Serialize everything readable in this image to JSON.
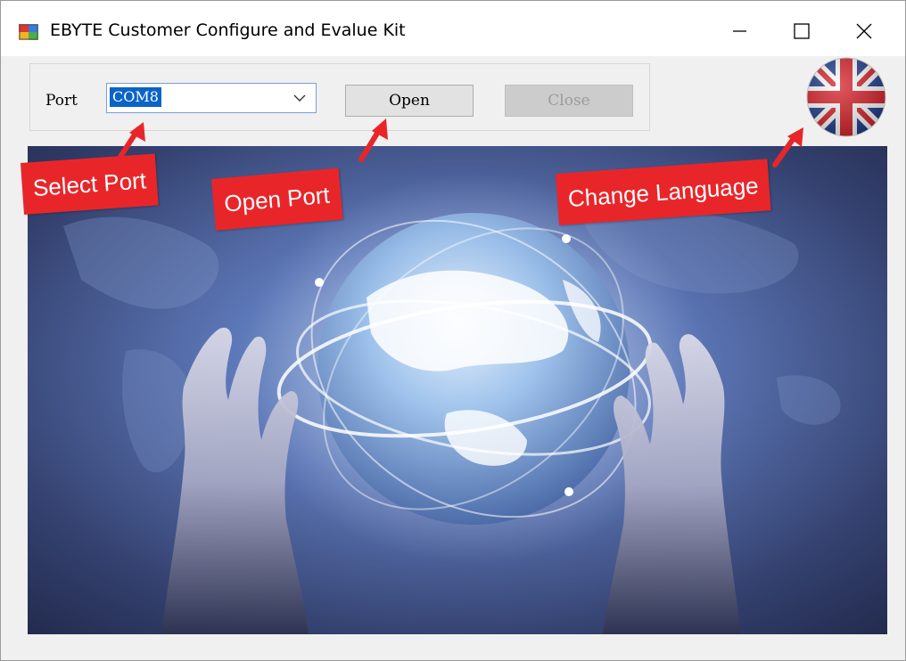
{
  "window": {
    "title": "EBYTE Customer Configure and Evalue Kit"
  },
  "icons": {
    "app": "app-window-icon",
    "minimize": "minimize-icon",
    "maximize": "maximize-icon",
    "close": "close-icon",
    "dropdown": "chevron-down-icon",
    "language": "uk-flag-icon",
    "arrow": "red-arrow-icon"
  },
  "port_panel": {
    "port_label": "Port",
    "port_value": "COM8",
    "open_label": "Open",
    "close_label": "Close"
  },
  "annotations": {
    "select_port": "Select Port",
    "open_port": "Open Port",
    "change_language": "Change Language"
  },
  "colors": {
    "annotation_red": "#e8262a",
    "selection_blue": "#0a64c8",
    "banner_dark": "#28335f",
    "banner_light": "#6f8ec7"
  }
}
